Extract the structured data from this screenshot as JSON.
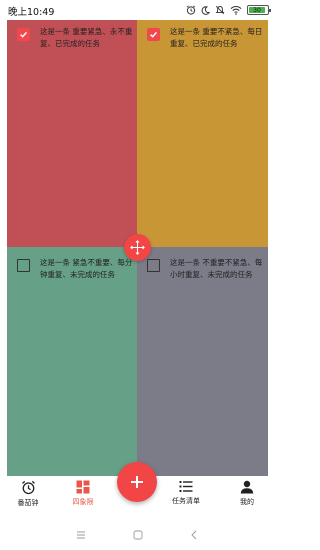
{
  "status_bar": {
    "time": "晚上10:49",
    "battery": "30",
    "icons": [
      "alarm-icon",
      "moon-icon",
      "mute-icon",
      "wifi-icon",
      "battery-icon"
    ]
  },
  "quadrants": [
    {
      "color": "#c15056",
      "task": {
        "text": "这是一条  重要紧急、永不重复、已完成的任务",
        "done": true
      }
    },
    {
      "color": "#c99636",
      "task": {
        "text": "这是一条  重要不紧急、每日重复、已完成的任务",
        "done": true
      }
    },
    {
      "color": "#66a087",
      "task": {
        "text": "这是一条  紧急不重要、每分钟重复、未完成的任务",
        "done": false
      }
    },
    {
      "color": "#7c7b88",
      "task": {
        "text": "这是一条  不重要不紧急、每小时重复、未完成的任务",
        "done": false
      }
    }
  ],
  "accent_color": "#f24545",
  "bottom_nav": {
    "items": [
      {
        "label": "番茄钟",
        "icon": "alarm-clock-icon",
        "active": false
      },
      {
        "label": "四象限",
        "icon": "quadrant-grid-icon",
        "active": true
      },
      {
        "label": "任务清单",
        "icon": "list-icon",
        "active": false
      },
      {
        "label": "我的",
        "icon": "person-icon",
        "active": false
      }
    ],
    "fab_icon": "plus-icon",
    "active_color": "#e9574a"
  },
  "system_nav": [
    "menu-icon",
    "home-icon",
    "back-icon"
  ]
}
